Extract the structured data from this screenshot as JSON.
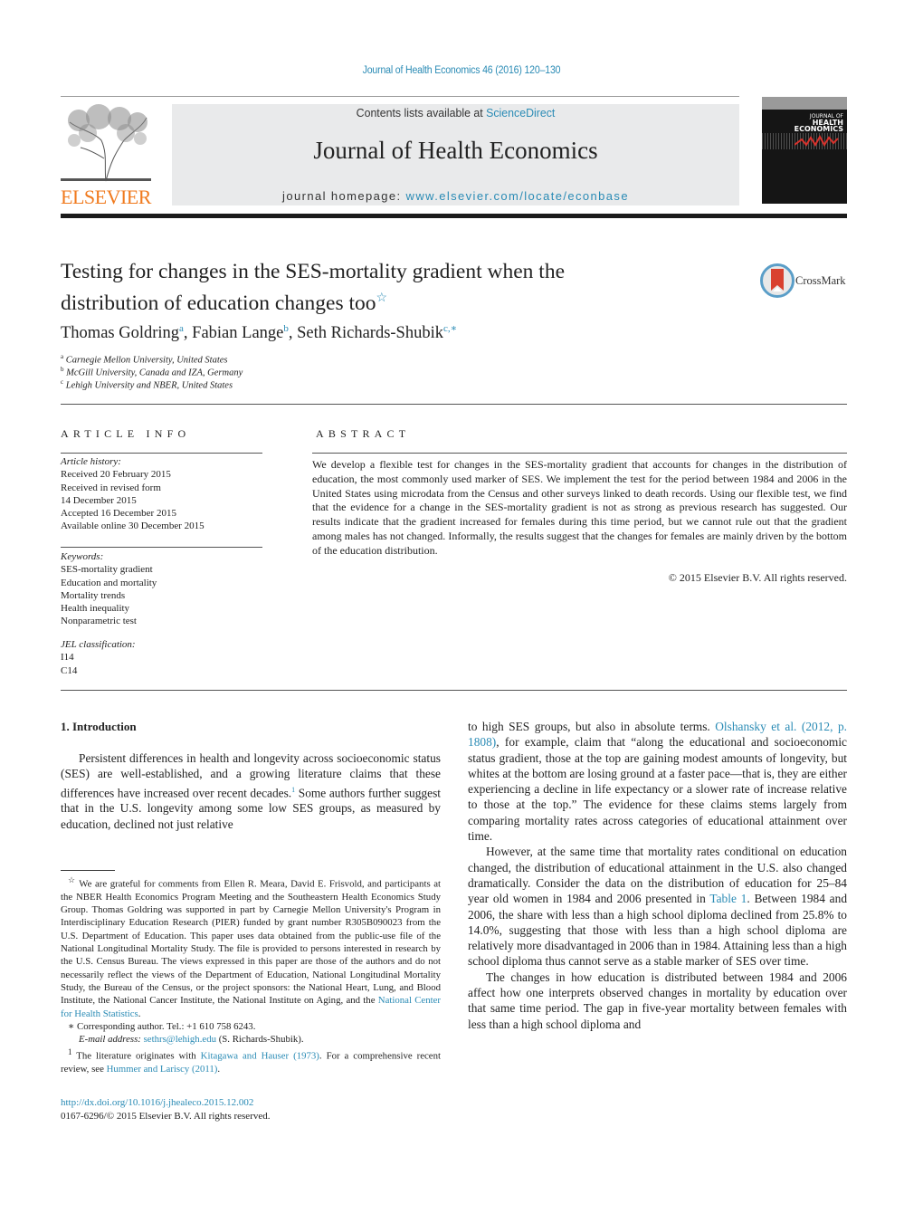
{
  "header": {
    "citation": "Journal of Health Economics 46 (2016) 120–130",
    "contents_prefix": "Contents lists available at ",
    "contents_link": "ScienceDirect",
    "journal_title": "Journal of Health Economics",
    "homepage_prefix": "journal homepage: ",
    "homepage_link": "www.elsevier.com/locate/econbase",
    "publisher_logo": "ELSEVIER",
    "cover": {
      "line1": "JOURNAL OF",
      "line2": "HEALTH",
      "line3": "ECONOMICS"
    },
    "colors": {
      "link": "#2a8bb5",
      "elsevier_orange": "#f07a1e",
      "masthead_bg": "#e9eaeb"
    }
  },
  "article": {
    "title_line1": "Testing for changes in the SES-mortality gradient when the",
    "title_line2": "distribution of education changes too",
    "title_mark": "☆",
    "crossmark_label": "CrossMark",
    "authors": [
      {
        "name": "Thomas Goldring",
        "sup": "a"
      },
      {
        "name": "Fabian Lange",
        "sup": "b"
      },
      {
        "name": "Seth Richards-Shubik",
        "sup": "c,∗"
      }
    ],
    "affiliations": [
      {
        "sup": "a",
        "text": "Carnegie Mellon University, United States"
      },
      {
        "sup": "b",
        "text": "McGill University, Canada and IZA, Germany"
      },
      {
        "sup": "c",
        "text": "Lehigh University and NBER, United States"
      }
    ]
  },
  "article_info": {
    "heading": "ARTICLE INFO",
    "history_label": "Article history:",
    "history": [
      "Received 20 February 2015",
      "Received in revised form",
      "14 December 2015",
      "Accepted 16 December 2015",
      "Available online 30 December 2015"
    ],
    "keywords_label": "Keywords:",
    "keywords": [
      "SES-mortality gradient",
      "Education and mortality",
      "Mortality trends",
      "Health inequality",
      "Nonparametric test"
    ],
    "jel_label": "JEL classification:",
    "jel": [
      "I14",
      "C14"
    ]
  },
  "abstract": {
    "heading": "ABSTRACT",
    "text": "We develop a flexible test for changes in the SES-mortality gradient that accounts for changes in the distribution of education, the most commonly used marker of SES. We implement the test for the period between 1984 and 2006 in the United States using microdata from the Census and other surveys linked to death records. Using our flexible test, we find that the evidence for a change in the SES-mortality gradient is not as strong as previous research has suggested. Our results indicate that the gradient increased for females during this time period, but we cannot rule out that the gradient among males has not changed. Informally, the results suggest that the changes for females are mainly driven by the bottom of the education distribution.",
    "copyright": "© 2015 Elsevier B.V. All rights reserved."
  },
  "body": {
    "section_heading": "1.  Introduction",
    "p1_text": "Persistent differences in health and longevity across socioeco­nomic status (SES) are well-established, and a growing literature claims that these differences have increased over recent decades.",
    "p1_fn": "1",
    "p1_text2": " Some authors further suggest that in the U.S. longevity among some low SES groups, as measured by education, declined not just relative",
    "p1_cont_a": "to high SES groups, but also in absolute terms. ",
    "p1_cont_link": "Olshansky et al. (2012, p. 1808)",
    "p1_cont_b": ", for example, claim that “along the educational and socioeconomic status gradient, those at the top are gaining modest amounts of longevity, but whites at the bottom are losing ground at a faster pace—that is, they are either experiencing a decline in life expectancy or a slower rate of increase relative to those at the top.” The evidence for these claims stems largely from comparing mortality rates across categories of educational attainment over time.",
    "p2_a": "However, at the same time that mortality rates conditional on education changed, the distribution of educational attainment in the U.S. also changed dramatically. Consider the data on the distri­bution of education for 25–84 year old women in 1984 and 2006 presented in ",
    "p2_link": "Table 1",
    "p2_b": ". Between 1984 and 2006, the share with less than a high school diploma declined from 25.8% to 14.0%, suggest­ing that those with less than a high school diploma are relatively more disadvantaged in 2006 than in 1984. Attaining less than a high school diploma thus cannot serve as a stable marker of SES over time.",
    "p3": "The changes in how education is distributed between 1984 and 2006 affect how one interprets observed changes in mortality by education over that same time period. The gap in five-year mor­tality between females with less than a high school diploma and"
  },
  "footnotes": {
    "star_mark": "☆",
    "star_a": " We are grateful for comments from Ellen R. Meara, David E. Frisvold, and partici­pants at the NBER Health Economics Program Meeting and the Southeastern Health Economics Study Group. Thomas Goldring was supported in part by Carnegie Mel­lon University's Program in Interdisciplinary Education Research (PIER) funded by grant number R305B090023 from the U.S. Department of Education. This paper uses data obtained from the public-use file of the National Longitudinal Mortality Study. The file is provided to persons interested in research by the U.S. Census Bureau. The views expressed in this paper are those of the authors and do not necessarily reflect the views of the Department of Education, National Longitudinal Mortality Study, the Bureau of the Census, or the project sponsors: the National Heart, Lung, and Blood Institute, the National Cancer Institute, the National Institute on Aging, and the ",
    "star_link": "National Center for Health Statistics",
    "star_end": ".",
    "corr_mark": "∗",
    "corr_text": " Corresponding author. Tel.: +1 610 758 6243.",
    "email_label": "E-mail address:",
    "email": "sethrs@lehigh.edu",
    "email_suffix": " (S. Richards-Shubik).",
    "fn1_mark": "1",
    "fn1_a": " The literature originates with ",
    "fn1_link1": "Kitagawa and Hauser (1973)",
    "fn1_b": ". For a comprehensive recent review, see ",
    "fn1_link2": "Hummer and Lariscy (2011)",
    "fn1_end": "."
  },
  "doi": {
    "link": "http://dx.doi.org/10.1016/j.jhealeco.2015.12.002",
    "issn_line": "0167-6296/© 2015 Elsevier B.V. All rights reserved."
  }
}
